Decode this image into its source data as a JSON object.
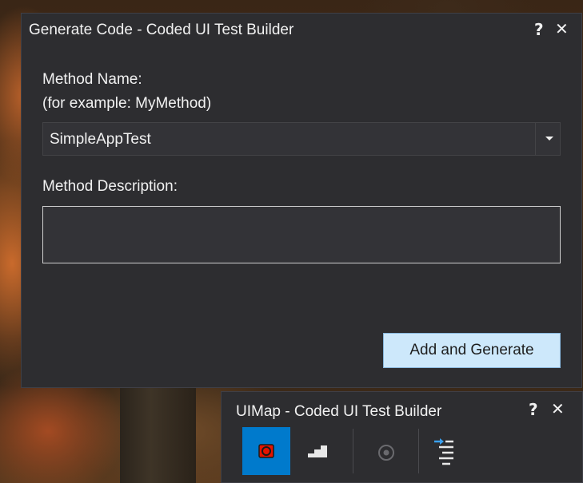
{
  "dialog": {
    "title": "Generate Code - Coded UI Test Builder",
    "help_label": "?",
    "close_label": "✕",
    "method_name_label": "Method Name:",
    "method_name_hint": "(for example: MyMethod)",
    "method_name_value": "SimpleAppTest",
    "method_description_label": "Method Description:",
    "method_description_value": "",
    "add_generate_label": "Add and Generate"
  },
  "uimap": {
    "title": "UIMap - Coded UI Test Builder",
    "help_label": "?",
    "close_label": "✕",
    "tools": [
      {
        "icon": "record-icon",
        "active": true
      },
      {
        "icon": "recorded-steps-icon",
        "active": false
      },
      {
        "icon": "add-assertion-icon",
        "active": false
      },
      {
        "icon": "generate-code-icon",
        "active": false
      }
    ]
  },
  "colors": {
    "window_bg": "#2d2d30",
    "text": "#f1f1f1",
    "accent": "#007acc",
    "record_red": "#e51400",
    "button_bg": "#cde8fb"
  }
}
